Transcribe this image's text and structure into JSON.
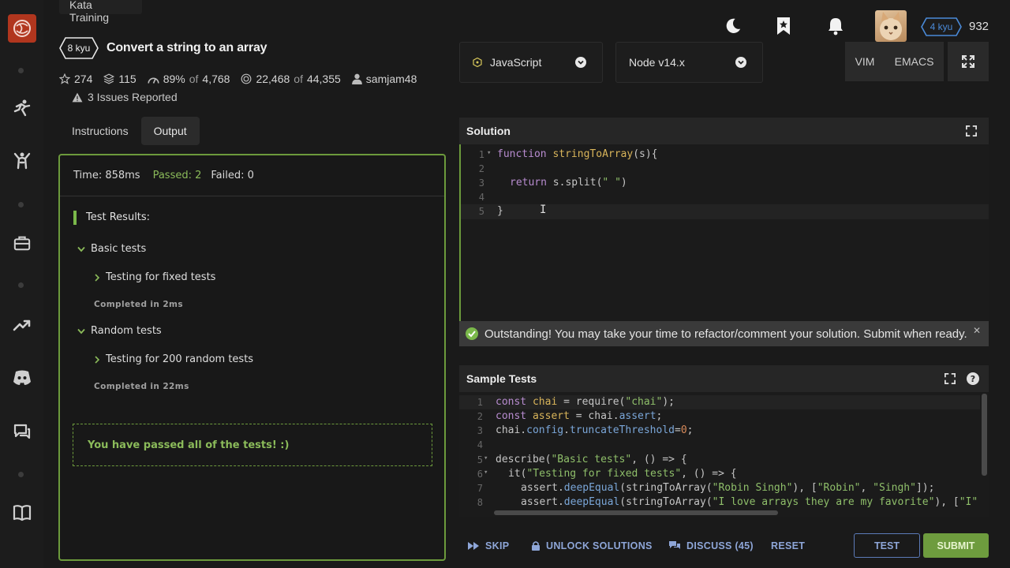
{
  "topbar": {
    "kata_training": "Kata Training",
    "rank": "4 kyu",
    "honor": "932",
    "icons": [
      "moon-icon",
      "bookmark-icon",
      "bell-icon"
    ]
  },
  "kata": {
    "kyu": "8 kyu",
    "title": "Convert a string to an array",
    "stars": "274",
    "collections": "115",
    "satisfaction_pct": "89%",
    "satisfaction_of": "of",
    "satisfaction_votes": "4,768",
    "completed": "22,468",
    "completed_of": "of",
    "attempted": "44,355",
    "author": "samjam48",
    "issues": "3 Issues Reported"
  },
  "tabs": [
    {
      "label": "Instructions"
    },
    {
      "label": "Output"
    }
  ],
  "output": {
    "time": "Time: 858ms",
    "passed": "Passed: 2",
    "failed": "Failed: 0",
    "results_title": "Test Results:",
    "groups": [
      {
        "name": "Basic tests",
        "test": "Testing for fixed tests",
        "completed": "Completed in 2ms"
      },
      {
        "name": "Random tests",
        "test": "Testing for 200 random tests",
        "completed": "Completed in 22ms"
      }
    ],
    "all_passed": "You have passed all of the tests! :)"
  },
  "language": {
    "selected": "JavaScript"
  },
  "runtime": {
    "selected": "Node v14.x"
  },
  "editor_modes": {
    "vim": "VIM",
    "emacs": "EMACS"
  },
  "solution": {
    "header": "Solution",
    "line_numbers": [
      "1",
      "2",
      "3",
      "4",
      "5"
    ],
    "banner": "Outstanding! You may take your time to refactor/comment your solution. Submit when ready."
  },
  "sample_tests": {
    "header": "Sample Tests",
    "line_numbers": [
      "1",
      "2",
      "3",
      "4",
      "5",
      "6",
      "7",
      "8"
    ]
  },
  "actions": {
    "skip": "SKIP",
    "unlock": "UNLOCK SOLUTIONS",
    "discuss": "DISCUSS (45)",
    "reset": "RESET",
    "test": "TEST",
    "submit": "SUBMIT"
  },
  "colors": {
    "accent_green": "#6e9c3e",
    "link_blue": "#8ea6d8",
    "logo_red": "#b1361e"
  }
}
